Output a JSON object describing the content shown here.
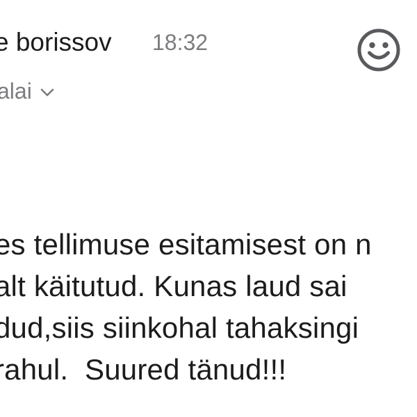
{
  "header": {
    "sender": "e borissov",
    "time": "18:32",
    "recipient": "alai",
    "emoji_icon": "smiley-icon",
    "chevron_icon": "chevron-down-icon"
  },
  "message": {
    "lines": [
      "es tellimuse esitamisest on n",
      "alt käitutud. Kunas laud sai",
      "dud,siis siinkohal tahaksingi",
      "rahul.  Suured tänud!!!"
    ]
  },
  "colors": {
    "text": "#1c1c1e",
    "secondary": "#7c7c80",
    "icon": "#5a5a5e"
  }
}
